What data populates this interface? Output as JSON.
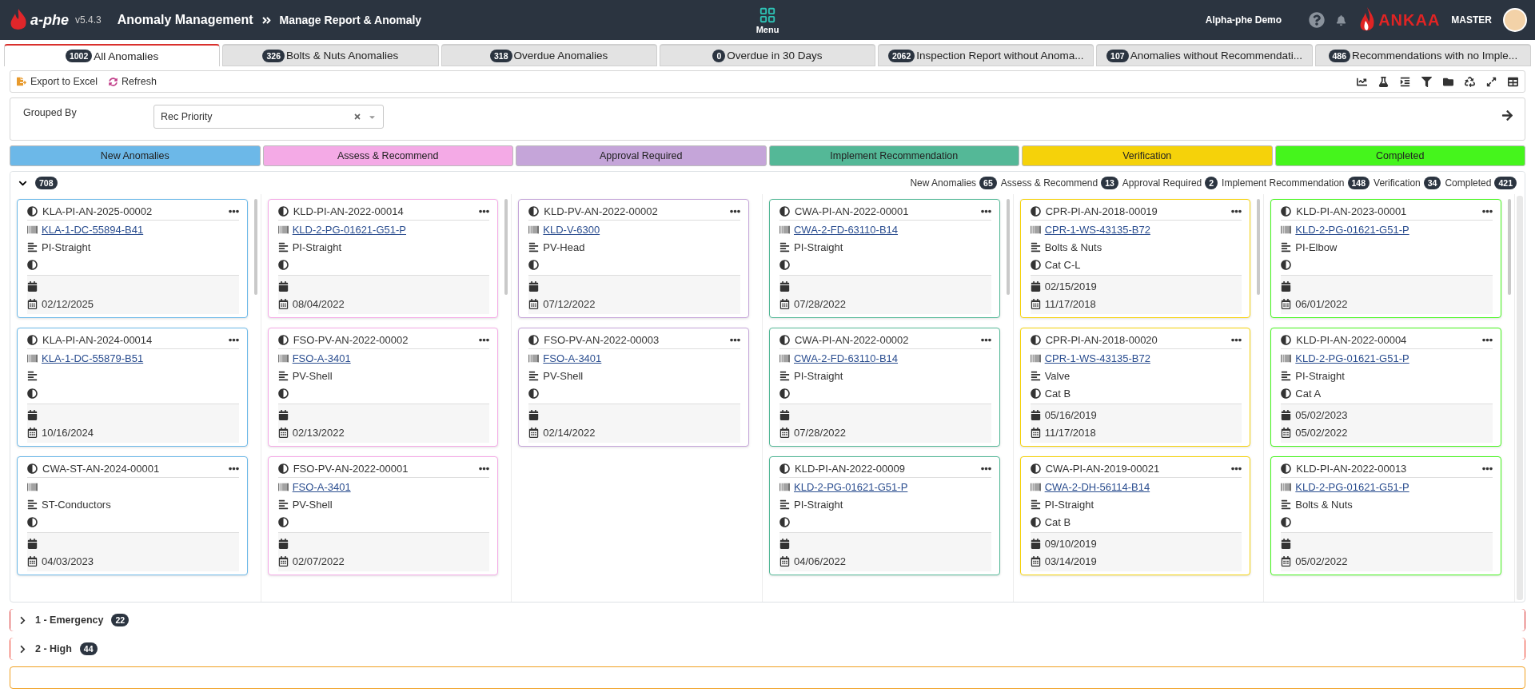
{
  "header": {
    "logo": "a-phe",
    "version": "v5.4.3",
    "module": "Anomaly Management",
    "page": "Manage Report & Anomaly",
    "menu": "Menu",
    "company": "Alpha-phe Demo",
    "brand": "ANKAA",
    "user": "MASTER"
  },
  "tabs": [
    {
      "count": "1002",
      "label": "All Anomalies",
      "selected": true
    },
    {
      "count": "326",
      "label": "Bolts & Nuts Anomalies",
      "selected": false
    },
    {
      "count": "318",
      "label": "Overdue Anomalies",
      "selected": false
    },
    {
      "count": "0",
      "label": "Overdue in 30 Days",
      "selected": false
    },
    {
      "count": "2062",
      "label": "Inspection Report without Anoma...",
      "selected": false
    },
    {
      "count": "107",
      "label": "Anomalies without Recommendati...",
      "selected": false
    },
    {
      "count": "486",
      "label": "Recommendations with no Imple...",
      "selected": false
    }
  ],
  "toolbar": {
    "buttons": [
      {
        "kind": "export",
        "label": "Export to Excel"
      },
      {
        "kind": "refresh",
        "label": "Refresh"
      }
    ]
  },
  "grouping": {
    "label": "Grouped By",
    "value": "Rec Priority"
  },
  "stages": [
    {
      "label": "New Anomalies",
      "color": "#6cb8e8"
    },
    {
      "label": "Assess & Recommend",
      "color": "#f4aae6"
    },
    {
      "label": "Approval Required",
      "color": "#c5a5d9"
    },
    {
      "label": "Implement Recommendation",
      "color": "#54b897"
    },
    {
      "label": "Verification",
      "color": "#f5d20a"
    },
    {
      "label": "Completed",
      "color": "#45f51c"
    }
  ],
  "groups": [
    {
      "count": "708",
      "expanded": true,
      "color": "#dee2e6",
      "summary": [
        {
          "label": "New Anomalies",
          "count": "65"
        },
        {
          "label": "Assess & Recommend",
          "count": "13"
        },
        {
          "label": "Approval Required",
          "count": "2"
        },
        {
          "label": "Implement Recommendation",
          "count": "148"
        },
        {
          "label": "Verification",
          "count": "34"
        },
        {
          "label": "Completed",
          "count": "421"
        }
      ],
      "lanes": [
        {
          "cards": [
            {
              "id": "KLA-PI-AN-2025-00002",
              "tag": "KLA-1-DC-55894-B41",
              "type": "PI-Straight",
              "date_2": "02/12/2025"
            },
            {
              "id": "KLA-PI-AN-2024-00014",
              "tag": "KLA-1-DC-55879-B51",
              "date_2": "10/16/2024"
            },
            {
              "id": "CWA-ST-AN-2024-00001",
              "type": "ST-Conductors",
              "date_2": "04/03/2023"
            }
          ]
        },
        {
          "cards": [
            {
              "id": "KLD-PI-AN-2022-00014",
              "tag": "KLD-2-PG-01621-G51-P",
              "type": "PI-Straight",
              "date_2": "08/04/2022"
            },
            {
              "id": "FSO-PV-AN-2022-00002",
              "tag": "FSO-A-3401",
              "type": "PV-Shell",
              "date_2": "02/13/2022"
            },
            {
              "id": "FSO-PV-AN-2022-00001",
              "tag": "FSO-A-3401",
              "type": "PV-Shell",
              "date_2": "02/07/2022"
            }
          ]
        },
        {
          "cards": [
            {
              "id": "KLD-PV-AN-2022-00002",
              "tag": "KLD-V-6300",
              "type": "PV-Head",
              "date_2": "07/12/2022"
            },
            {
              "id": "FSO-PV-AN-2022-00003",
              "tag": "FSO-A-3401",
              "type": "PV-Shell",
              "date_2": "02/14/2022"
            }
          ]
        },
        {
          "cards": [
            {
              "id": "CWA-PI-AN-2022-00001",
              "tag": "CWA-2-FD-63110-B14",
              "type": "PI-Straight",
              "date_2": "07/28/2022"
            },
            {
              "id": "CWA-PI-AN-2022-00002",
              "tag": "CWA-2-FD-63110-B14",
              "type": "PI-Straight",
              "date_2": "07/28/2022"
            },
            {
              "id": "KLD-PI-AN-2022-00009",
              "tag": "KLD-2-PG-01621-G51-P",
              "type": "PI-Straight",
              "date_2": "04/06/2022"
            }
          ]
        },
        {
          "cards": [
            {
              "id": "CPR-PI-AN-2018-00019",
              "tag": "CPR-1-WS-43135-B72",
              "type": "Bolts & Nuts",
              "category": "Cat C-L",
              "date_1": "02/15/2019",
              "date_2": "11/17/2018"
            },
            {
              "id": "CPR-PI-AN-2018-00020",
              "tag": "CPR-1-WS-43135-B72",
              "type": "Valve",
              "category": "Cat B",
              "date_1": "05/16/2019",
              "date_2": "11/17/2018"
            },
            {
              "id": "CWA-PI-AN-2019-00021",
              "tag": "CWA-2-DH-56114-B14",
              "type": "PI-Straight",
              "category": "Cat B",
              "date_1": "09/10/2019",
              "date_2": "03/14/2019"
            }
          ]
        },
        {
          "cards": [
            {
              "id": "KLD-PI-AN-2023-00001",
              "tag": "KLD-2-PG-01621-G51-P",
              "type": "PI-Elbow",
              "date_2": "06/01/2022"
            },
            {
              "id": "KLD-PI-AN-2022-00004",
              "tag": "KLD-2-PG-01621-G51-P",
              "type": "PI-Straight",
              "category": "Cat A",
              "date_1": "05/02/2023",
              "date_2": "05/02/2022"
            },
            {
              "id": "KLD-PI-AN-2022-00013",
              "tag": "KLD-2-PG-01621-G51-P",
              "type": "Bolts & Nuts",
              "date_2": "05/02/2022"
            }
          ]
        }
      ]
    },
    {
      "label": "1 - Emergency",
      "count": "22",
      "expanded": false,
      "color": "#d92b2b"
    },
    {
      "label": "2 - High",
      "count": "44",
      "expanded": false,
      "color": "#ee3a2a"
    }
  ]
}
